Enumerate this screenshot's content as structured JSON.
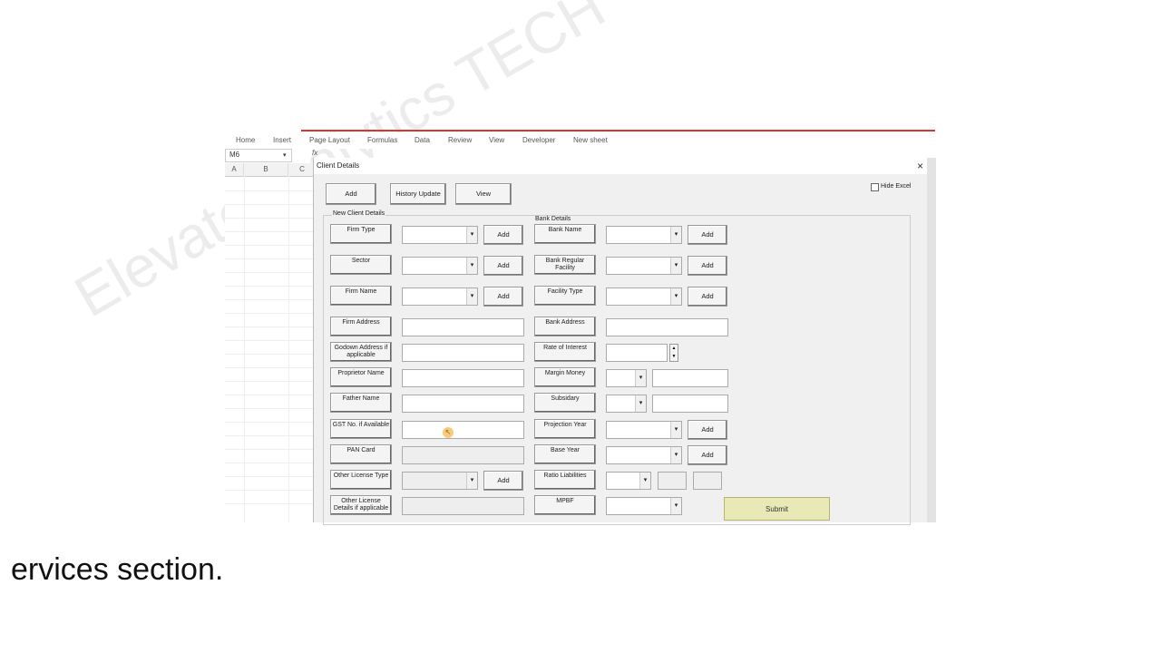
{
  "ribbon": {
    "tabs": [
      "Home",
      "Insert",
      "Page Layout",
      "Formulas",
      "Data",
      "Review",
      "View",
      "Developer",
      "New sheet"
    ]
  },
  "name_box": {
    "value": "M6"
  },
  "formula_bar": {
    "fx_label": "fx"
  },
  "sheet": {
    "column_headers": [
      "A",
      "B",
      "C"
    ]
  },
  "dialog": {
    "title": "Client Details",
    "close_label": "×",
    "top_buttons": {
      "add": "Add",
      "history_update": "History Update",
      "view": "View"
    },
    "hide_excel_label": "Hide Excel",
    "submit_label": "Submit",
    "new_client_section": {
      "caption": "New Client Details",
      "firm_type": "Firm Type",
      "sector": "Sector",
      "firm_name": "Firm Name",
      "firm_address": "Firm Address",
      "godown_address": "Godown Address if applicable",
      "proprietor_name": "Proprietor Name",
      "father_name": "Father Name",
      "gst_no": "GST No. if Available",
      "pan_card": "PAN Card",
      "other_license_type": "Other License Type",
      "other_license_details": "Other License Details if applicable",
      "add_label": "Add"
    },
    "bank_section": {
      "caption": "Bank Details",
      "bank_name": "Bank Name",
      "bank_regular_facility": "Bank Regular Facility",
      "facility_type": "Facility Type",
      "bank_address": "Bank Address",
      "rate_of_interest": "Rate of Interest",
      "margin_money": "Margin Money",
      "subsidary": "Subsidary",
      "projection_year": "Projection Year",
      "base_year": "Base Year",
      "ratio_liabilities": "Ratio Liabilities",
      "mpbf": "MPBF",
      "add_label": "Add"
    }
  },
  "overlay": {
    "watermark": "ElevateAnalytics TECH",
    "caption": "ervices section."
  },
  "colors": {
    "submit_bg": "#e9e9b7",
    "ribbon_accent": "#dd3333"
  }
}
